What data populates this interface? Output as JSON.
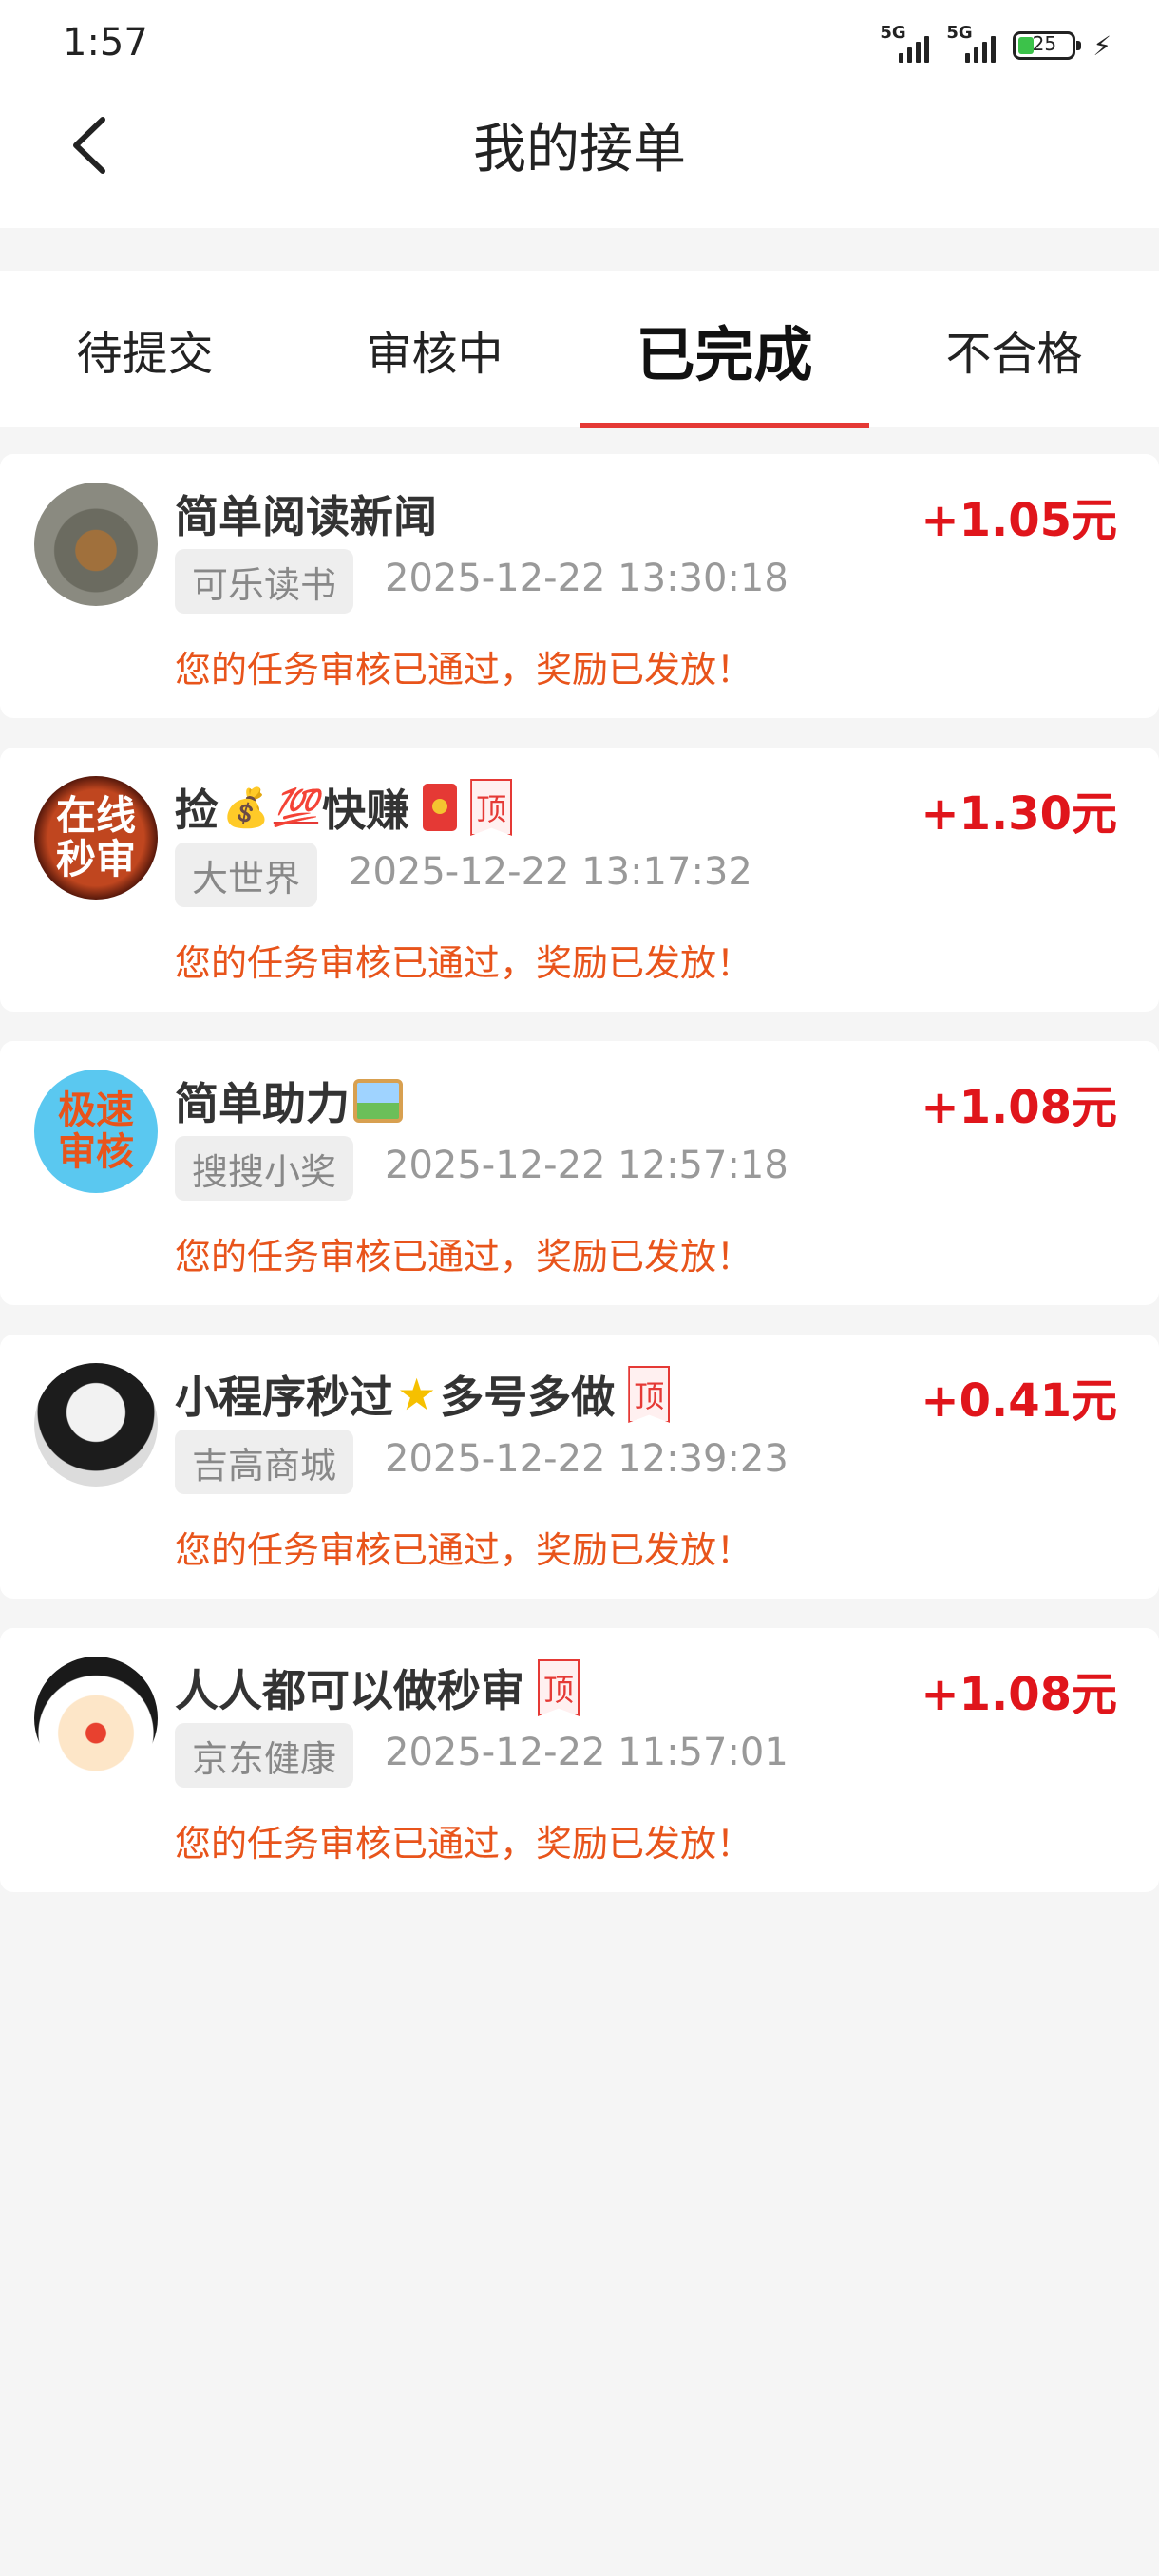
{
  "status_bar": {
    "time": "1:57",
    "signal1_label": "5G",
    "signal2_label": "5G",
    "battery": "25"
  },
  "header": {
    "title": "我的接单"
  },
  "tabs": [
    {
      "label": "待提交",
      "active": false
    },
    {
      "label": "审核中",
      "active": false
    },
    {
      "label": "已完成",
      "active": true
    },
    {
      "label": "不合格",
      "active": false
    }
  ],
  "orders": [
    {
      "title": "简单阅读新闻",
      "shop": "可乐读书",
      "time": "2025-12-22 13:30:18",
      "amount": "+1.05元",
      "status": "您的任务审核已通过，奖励已发放！"
    },
    {
      "title_a": "捡",
      "title_b": "快赚",
      "pin": "顶",
      "shop": "大世界",
      "time": "2025-12-22 13:17:32",
      "amount": "+1.30元",
      "status": "您的任务审核已通过，奖励已发放！"
    },
    {
      "title": "简单助力",
      "shop": "搜搜小奖",
      "time": "2025-12-22 12:57:18",
      "amount": "+1.08元",
      "status": "您的任务审核已通过，奖励已发放！"
    },
    {
      "title_a": "小程序秒过",
      "title_b": "多号多做",
      "pin": "顶",
      "shop": "吉高商城",
      "time": "2025-12-22 12:39:23",
      "amount": "+0.41元",
      "status": "您的任务审核已通过，奖励已发放！"
    },
    {
      "title": "人人都可以做秒审",
      "pin": "顶",
      "shop": "京东健康",
      "time": "2025-12-22 11:57:01",
      "amount": "+1.08元",
      "status": "您的任务审核已通过，奖励已发放！"
    }
  ],
  "avatar_text": {
    "a2": "在线秒审",
    "a3": "极速审核"
  },
  "colors": {
    "accent": "#e53935",
    "amount": "#e0151b",
    "status": "#e8541b"
  }
}
